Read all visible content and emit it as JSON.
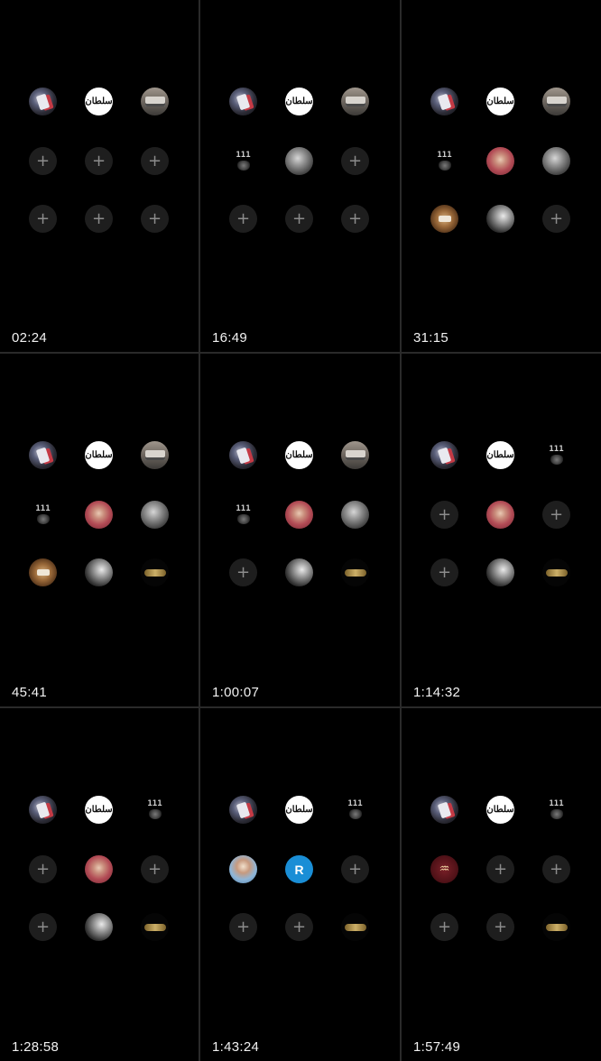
{
  "panels": [
    {
      "timestamp": "02:24",
      "slots": [
        "cards",
        "script",
        "truck",
        "empty",
        "empty",
        "empty",
        "empty",
        "empty",
        "empty"
      ]
    },
    {
      "timestamp": "16:49",
      "slots": [
        "cards",
        "script",
        "truck",
        "111",
        "grayface",
        "empty",
        "empty",
        "empty",
        "empty"
      ]
    },
    {
      "timestamp": "31:15",
      "slots": [
        "cards",
        "script",
        "truck",
        "111",
        "redfold",
        "grayface",
        "sack",
        "bwportrait",
        "empty"
      ]
    },
    {
      "timestamp": "45:41",
      "slots": [
        "cards",
        "script",
        "truck",
        "111",
        "redfold",
        "grayface",
        "sack",
        "bwportrait",
        "goldlogo"
      ]
    },
    {
      "timestamp": "1:00:07",
      "slots": [
        "cards",
        "script",
        "truck",
        "111",
        "redfold",
        "grayface",
        "empty",
        "bwportrait",
        "goldlogo"
      ]
    },
    {
      "timestamp": "1:14:32",
      "slots": [
        "cards",
        "script",
        "111",
        "empty",
        "redfold",
        "empty",
        "empty",
        "bwportrait",
        "goldlogo"
      ]
    },
    {
      "timestamp": "1:28:58",
      "slots": [
        "cards",
        "script",
        "111",
        "empty",
        "redfold",
        "empty",
        "empty",
        "bwportrait",
        "goldlogo"
      ]
    },
    {
      "timestamp": "1:43:24",
      "slots": [
        "cards",
        "script",
        "111",
        "person",
        "letter",
        "empty",
        "empty",
        "empty",
        "goldlogo"
      ]
    },
    {
      "timestamp": "1:57:49",
      "slots": [
        "cards",
        "script",
        "111",
        "palm",
        "empty",
        "empty",
        "empty",
        "empty",
        "goldlogo"
      ]
    }
  ],
  "avatar_labels": {
    "script": "سلطان",
    "111": "111",
    "letter": "R",
    "empty": "+"
  },
  "icons": {
    "empty": "plus-icon",
    "palm": "palm-tree-icon"
  },
  "colors": {
    "background": "#000000",
    "divider": "#2a2a2a",
    "empty_slot": "#1e1e1e",
    "plus": "#8c8c8c",
    "timestamp": "#f2f2f2",
    "letter_avatar": "#1a8ed6"
  }
}
